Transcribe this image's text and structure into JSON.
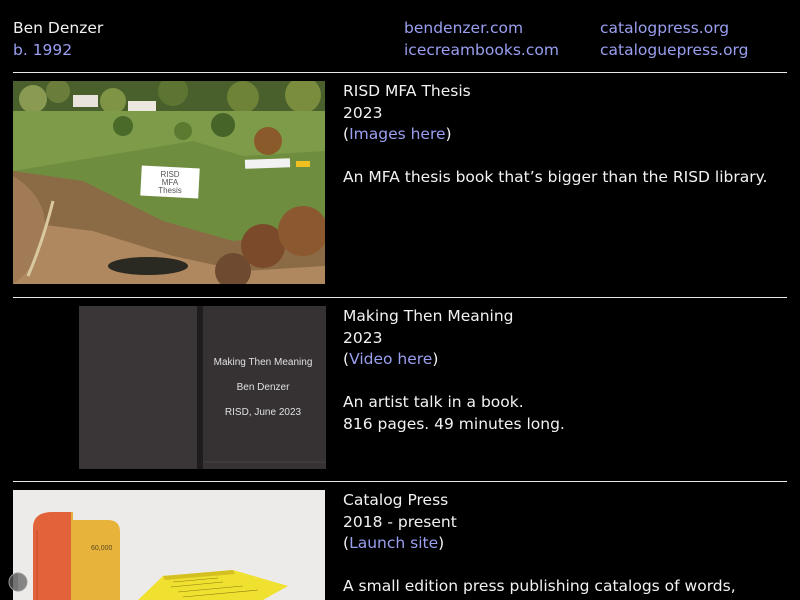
{
  "header": {
    "name": "Ben Denzer",
    "born": "b. 1992",
    "links_col1": [
      "bendenzer.com",
      "icecreambooks.com"
    ],
    "links_col2": [
      "catalogpress.org",
      "cataloguepress.org"
    ]
  },
  "entries": [
    {
      "title": "RISD MFA Thesis",
      "year": "2023",
      "link_open": "(",
      "link_label": "Images here",
      "link_close": ")",
      "desc1": "An MFA thesis book that’s bigger than the RISD library.",
      "image": {
        "sign_lines": [
          "RISD",
          "MFA",
          "Thesis"
        ]
      }
    },
    {
      "title": "Making Then Meaning",
      "year": "2023",
      "link_open": "(",
      "link_label": "Video here",
      "link_close": ")",
      "desc1": "An artist talk in a book.",
      "desc2": "816 pages. 49 minutes long.",
      "image": {
        "cover_title": "Making Then Meaning",
        "cover_author": "Ben Denzer",
        "cover_date": "RISD, June 2023"
      }
    },
    {
      "title": "Catalog Press",
      "year": "2018 - present",
      "link_open": "(",
      "link_label": "Launch site",
      "link_close": ")",
      "desc1": "A small edition press publishing catalogs of words,",
      "image": {
        "book_number": "60,000"
      }
    }
  ],
  "colors": {
    "background": "#000000",
    "text": "#f2f2f2",
    "link": "#9a9ff0",
    "rule": "#e8e8e8"
  }
}
